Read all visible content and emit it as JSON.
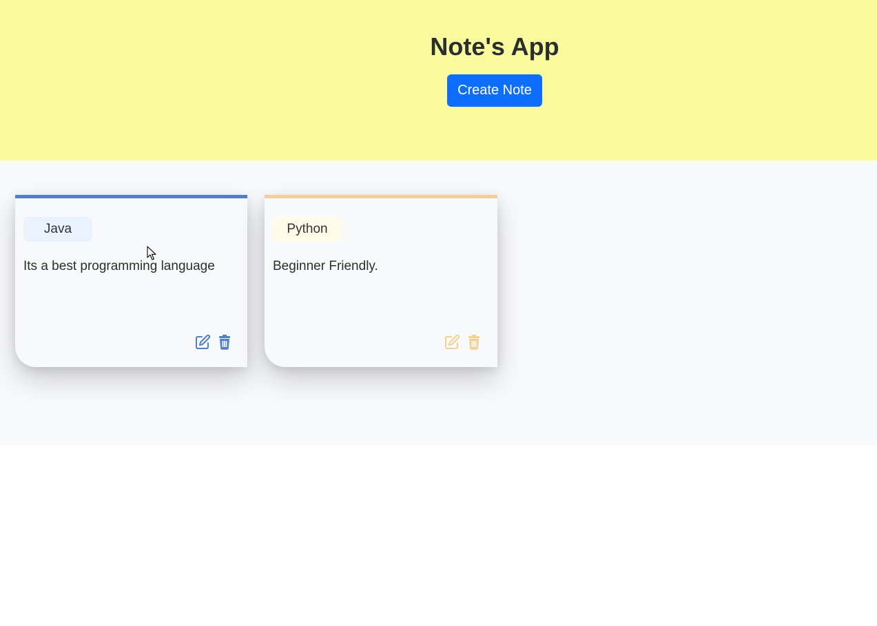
{
  "header": {
    "title": "Note's App",
    "create_label": "Create Note",
    "background": "#f9f99e"
  },
  "notes": [
    {
      "tag": "Java",
      "text": "Its a best programming language",
      "accent": "#4f7fc4",
      "edit_icon": "edit-icon",
      "delete_icon": "trash-icon"
    },
    {
      "tag": "Python",
      "text": "Beginner Friendly.",
      "accent": "#f5cf92",
      "edit_icon": "edit-icon",
      "delete_icon": "trash-icon"
    }
  ],
  "colors": {
    "primary_button": "#0d6efd",
    "section_background": "#f8f9fb"
  }
}
